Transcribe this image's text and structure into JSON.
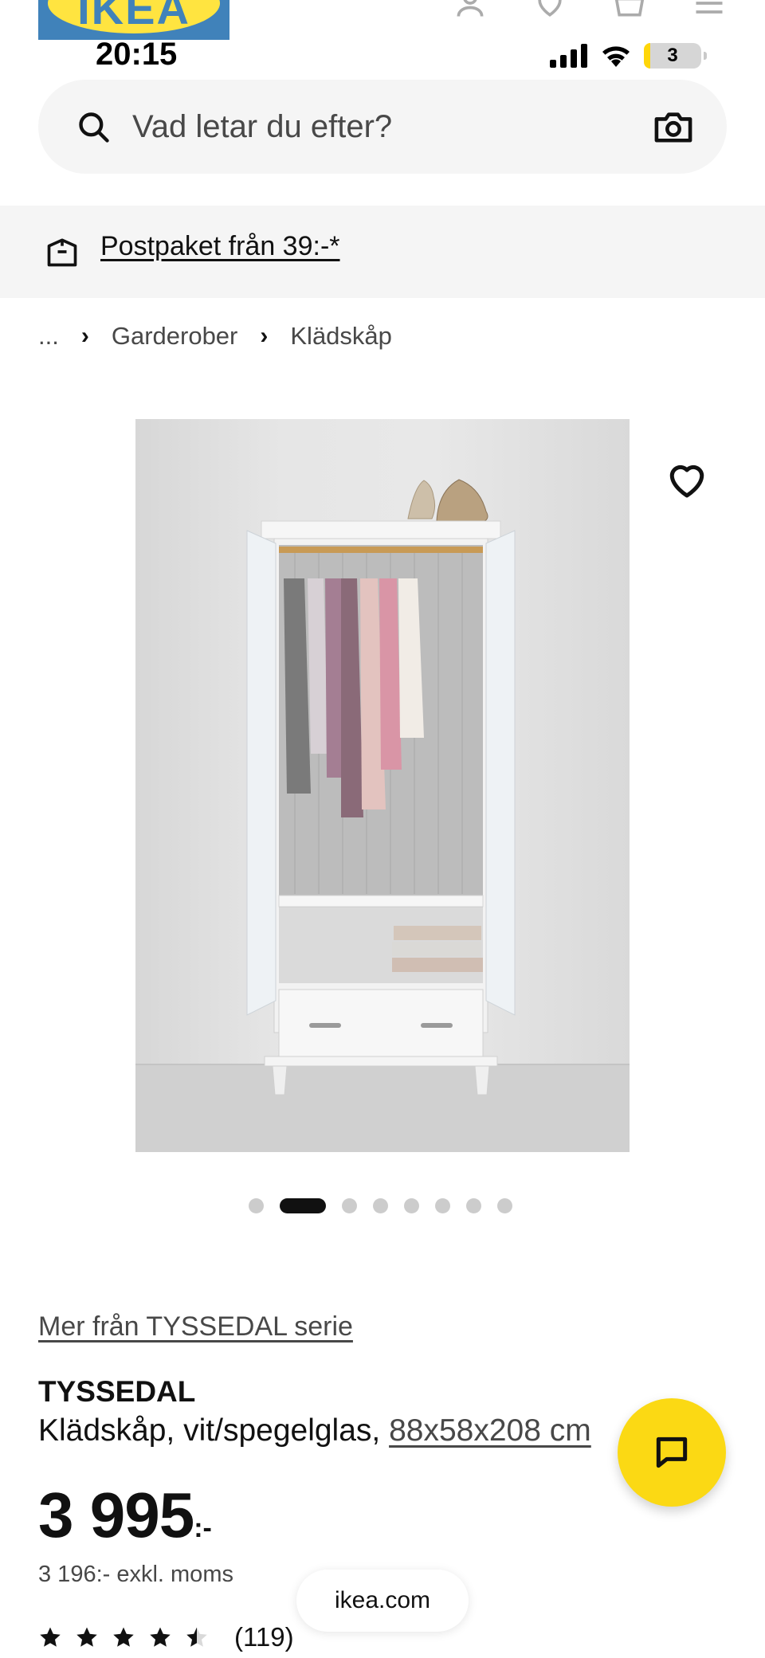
{
  "header": {
    "logo_text": "IKEA",
    "icons": [
      "profile-icon",
      "heart-icon",
      "basket-icon",
      "menu-icon"
    ]
  },
  "status_bar": {
    "time": "20:15",
    "battery": "3",
    "icons": [
      "signal-icon",
      "wifi-icon",
      "battery-icon"
    ]
  },
  "search": {
    "placeholder": "Vad letar du efter?",
    "value": ""
  },
  "promo": {
    "link": "Postpaket från 39:-*"
  },
  "breadcrumb": [
    "...",
    "Garderober",
    "Klädskåp"
  ],
  "gallery": {
    "dot_count": 8,
    "active_index": 1
  },
  "product": {
    "series_link": "Mer från TYSSEDAL serie",
    "name": "TYSSEDAL",
    "description": "Klädskåp, vit/spegelglas,",
    "dimensions": "88x58x208 cm",
    "price_main": "3 995",
    "price_suffix": ":-",
    "price_ex_vat": "3 196:- exkl. moms",
    "rating_value": 4.5,
    "rating_count": "(119)"
  },
  "browser": {
    "url": "ikea.com"
  },
  "colors": {
    "brand_blue": "#0058a3",
    "brand_yellow": "#ffdb00",
    "chat_yellow": "#fbd914"
  }
}
